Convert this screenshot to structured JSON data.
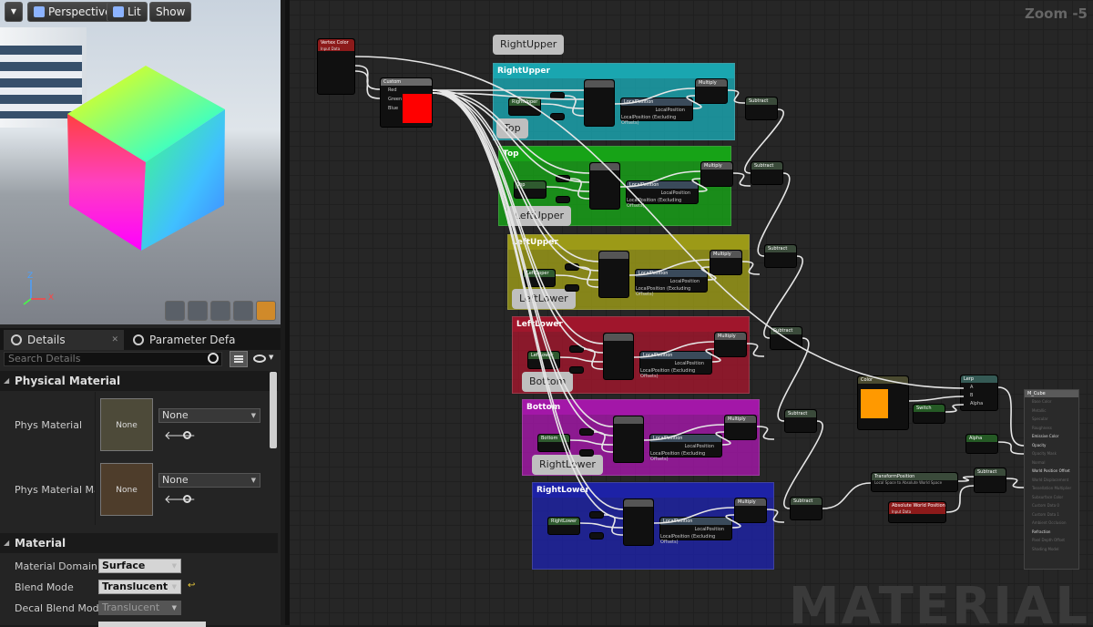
{
  "viewport": {
    "view_mode": "Perspective",
    "lighting": "Lit",
    "show": "Show",
    "axis_z": "Z",
    "axis_x": "X"
  },
  "tabs": [
    {
      "label": "Details"
    },
    {
      "label": "Parameter Defaults"
    }
  ],
  "details": {
    "search_placeholder": "Search Details",
    "physical_material_header": "Physical Material",
    "phys_material_label": "Phys Material",
    "phys_material_thumb": "None",
    "phys_material_value": "None",
    "phys_material_mask_label": "Phys Material Mask",
    "phys_material_mask_thumb": "None",
    "phys_material_mask_value": "None",
    "material_header": "Material",
    "material_domain_label": "Material Domain",
    "material_domain_value": "Surface",
    "blend_mode_label": "Blend Mode",
    "blend_mode_value": "Translucent",
    "decal_blend_mode_label": "Decal Blend Mode",
    "decal_blend_mode_value": "Translucent"
  },
  "graph": {
    "zoom": "Zoom -5",
    "watermark": "MATERIAL",
    "top_bubble": "RightUpper",
    "comments": [
      {
        "title": "RightUpper",
        "bubble": "Top",
        "color": "#1aa6b0"
      },
      {
        "title": "Top",
        "bubble": "LeftUpper",
        "color": "#17a317"
      },
      {
        "title": "LeftUpper",
        "bubble": "LeftLower",
        "color": "#9c9a17"
      },
      {
        "title": "LeftLower",
        "bubble": "Bottom",
        "color": "#a0162c"
      },
      {
        "title": "Bottom",
        "bubble": "RightLower",
        "color": "#a317a8"
      },
      {
        "title": "RightLower",
        "bubble": "",
        "color": "#1d22a6"
      }
    ],
    "nodes": {
      "vertex_color": "Vertex Color",
      "vertex_color_sub": "Input Data",
      "custom": "Custom",
      "custom_pins": [
        "Red",
        "Green",
        "Blue"
      ],
      "color": "Color",
      "switch": "Switch",
      "lerp": "Lerp",
      "lerp_pins": [
        "A",
        "B",
        "Alpha"
      ],
      "alpha": "Alpha",
      "transform_position": "TransformPosition",
      "transform_position_sub": "Local Space to Absolute World Space",
      "absolute_world_position": "Absolute World Position",
      "absolute_world_position_sub": "Input Data",
      "subtract": "Subtract",
      "multiply": "Multiply",
      "local_position": "LocalPosition",
      "local_position_excl": "LocalPosition (Excluding Offsets)"
    },
    "result": {
      "title": "M_Cube",
      "pins": [
        "Base Color",
        "Metallic",
        "Specular",
        "Roughness",
        "Emissive Color",
        "Opacity",
        "Opacity Mask",
        "Normal",
        "World Position Offset",
        "World Displacement",
        "Tessellation Multiplier",
        "Subsurface Color",
        "Custom Data 0",
        "Custom Data 1",
        "Ambient Occlusion",
        "Refraction",
        "Pixel Depth Offset",
        "Shading Model"
      ],
      "active": [
        4,
        5,
        8,
        15
      ]
    }
  }
}
